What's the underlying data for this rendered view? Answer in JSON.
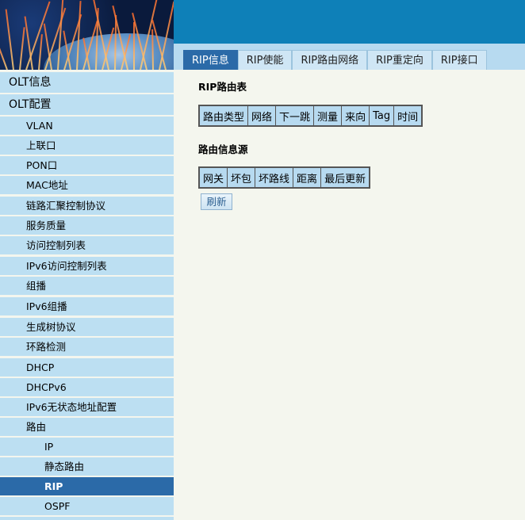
{
  "tabs": [
    {
      "label": "RIP信息",
      "active": true
    },
    {
      "label": "RIP使能"
    },
    {
      "label": "RIP路由网络"
    },
    {
      "label": "RIP重定向"
    },
    {
      "label": "RIP接口"
    }
  ],
  "sidebar": {
    "items": [
      {
        "label": "OLT信息",
        "level": 0
      },
      {
        "label": "OLT配置",
        "level": 0
      },
      {
        "label": "VLAN",
        "level": 1
      },
      {
        "label": "上联口",
        "level": 1
      },
      {
        "label": "PON口",
        "level": 1
      },
      {
        "label": "MAC地址",
        "level": 1
      },
      {
        "label": "链路汇聚控制协议",
        "level": 1
      },
      {
        "label": "服务质量",
        "level": 1
      },
      {
        "label": "访问控制列表",
        "level": 1
      },
      {
        "label": "IPv6访问控制列表",
        "level": 1
      },
      {
        "label": "组播",
        "level": 1
      },
      {
        "label": "IPv6组播",
        "level": 1
      },
      {
        "label": "生成树协议",
        "level": 1
      },
      {
        "label": "环路检测",
        "level": 1
      },
      {
        "label": "DHCP",
        "level": 1
      },
      {
        "label": "DHCPv6",
        "level": 1
      },
      {
        "label": "IPv6无状态地址配置",
        "level": 1
      },
      {
        "label": "路由",
        "level": 1
      },
      {
        "label": "IP",
        "level": 2
      },
      {
        "label": "静态路由",
        "level": 2
      },
      {
        "label": "RIP",
        "level": 2,
        "active": true
      },
      {
        "label": "OSPF",
        "level": 2
      }
    ]
  },
  "main": {
    "rip_table": {
      "title": "RIP路由表",
      "headers": [
        "路由类型",
        "网络",
        "下一跳",
        "测量",
        "来向",
        "Tag",
        "时间"
      ]
    },
    "source_table": {
      "title": "路由信息源",
      "headers": [
        "网关",
        "坏包",
        "坏路线",
        "距离",
        "最后更新"
      ]
    },
    "refresh_label": "刷新"
  },
  "colors": {
    "banner": "#0e80b8",
    "nav_bg": "#bcdff2",
    "active": "#2b6aa8",
    "page_bg": "#f4f6ee"
  }
}
